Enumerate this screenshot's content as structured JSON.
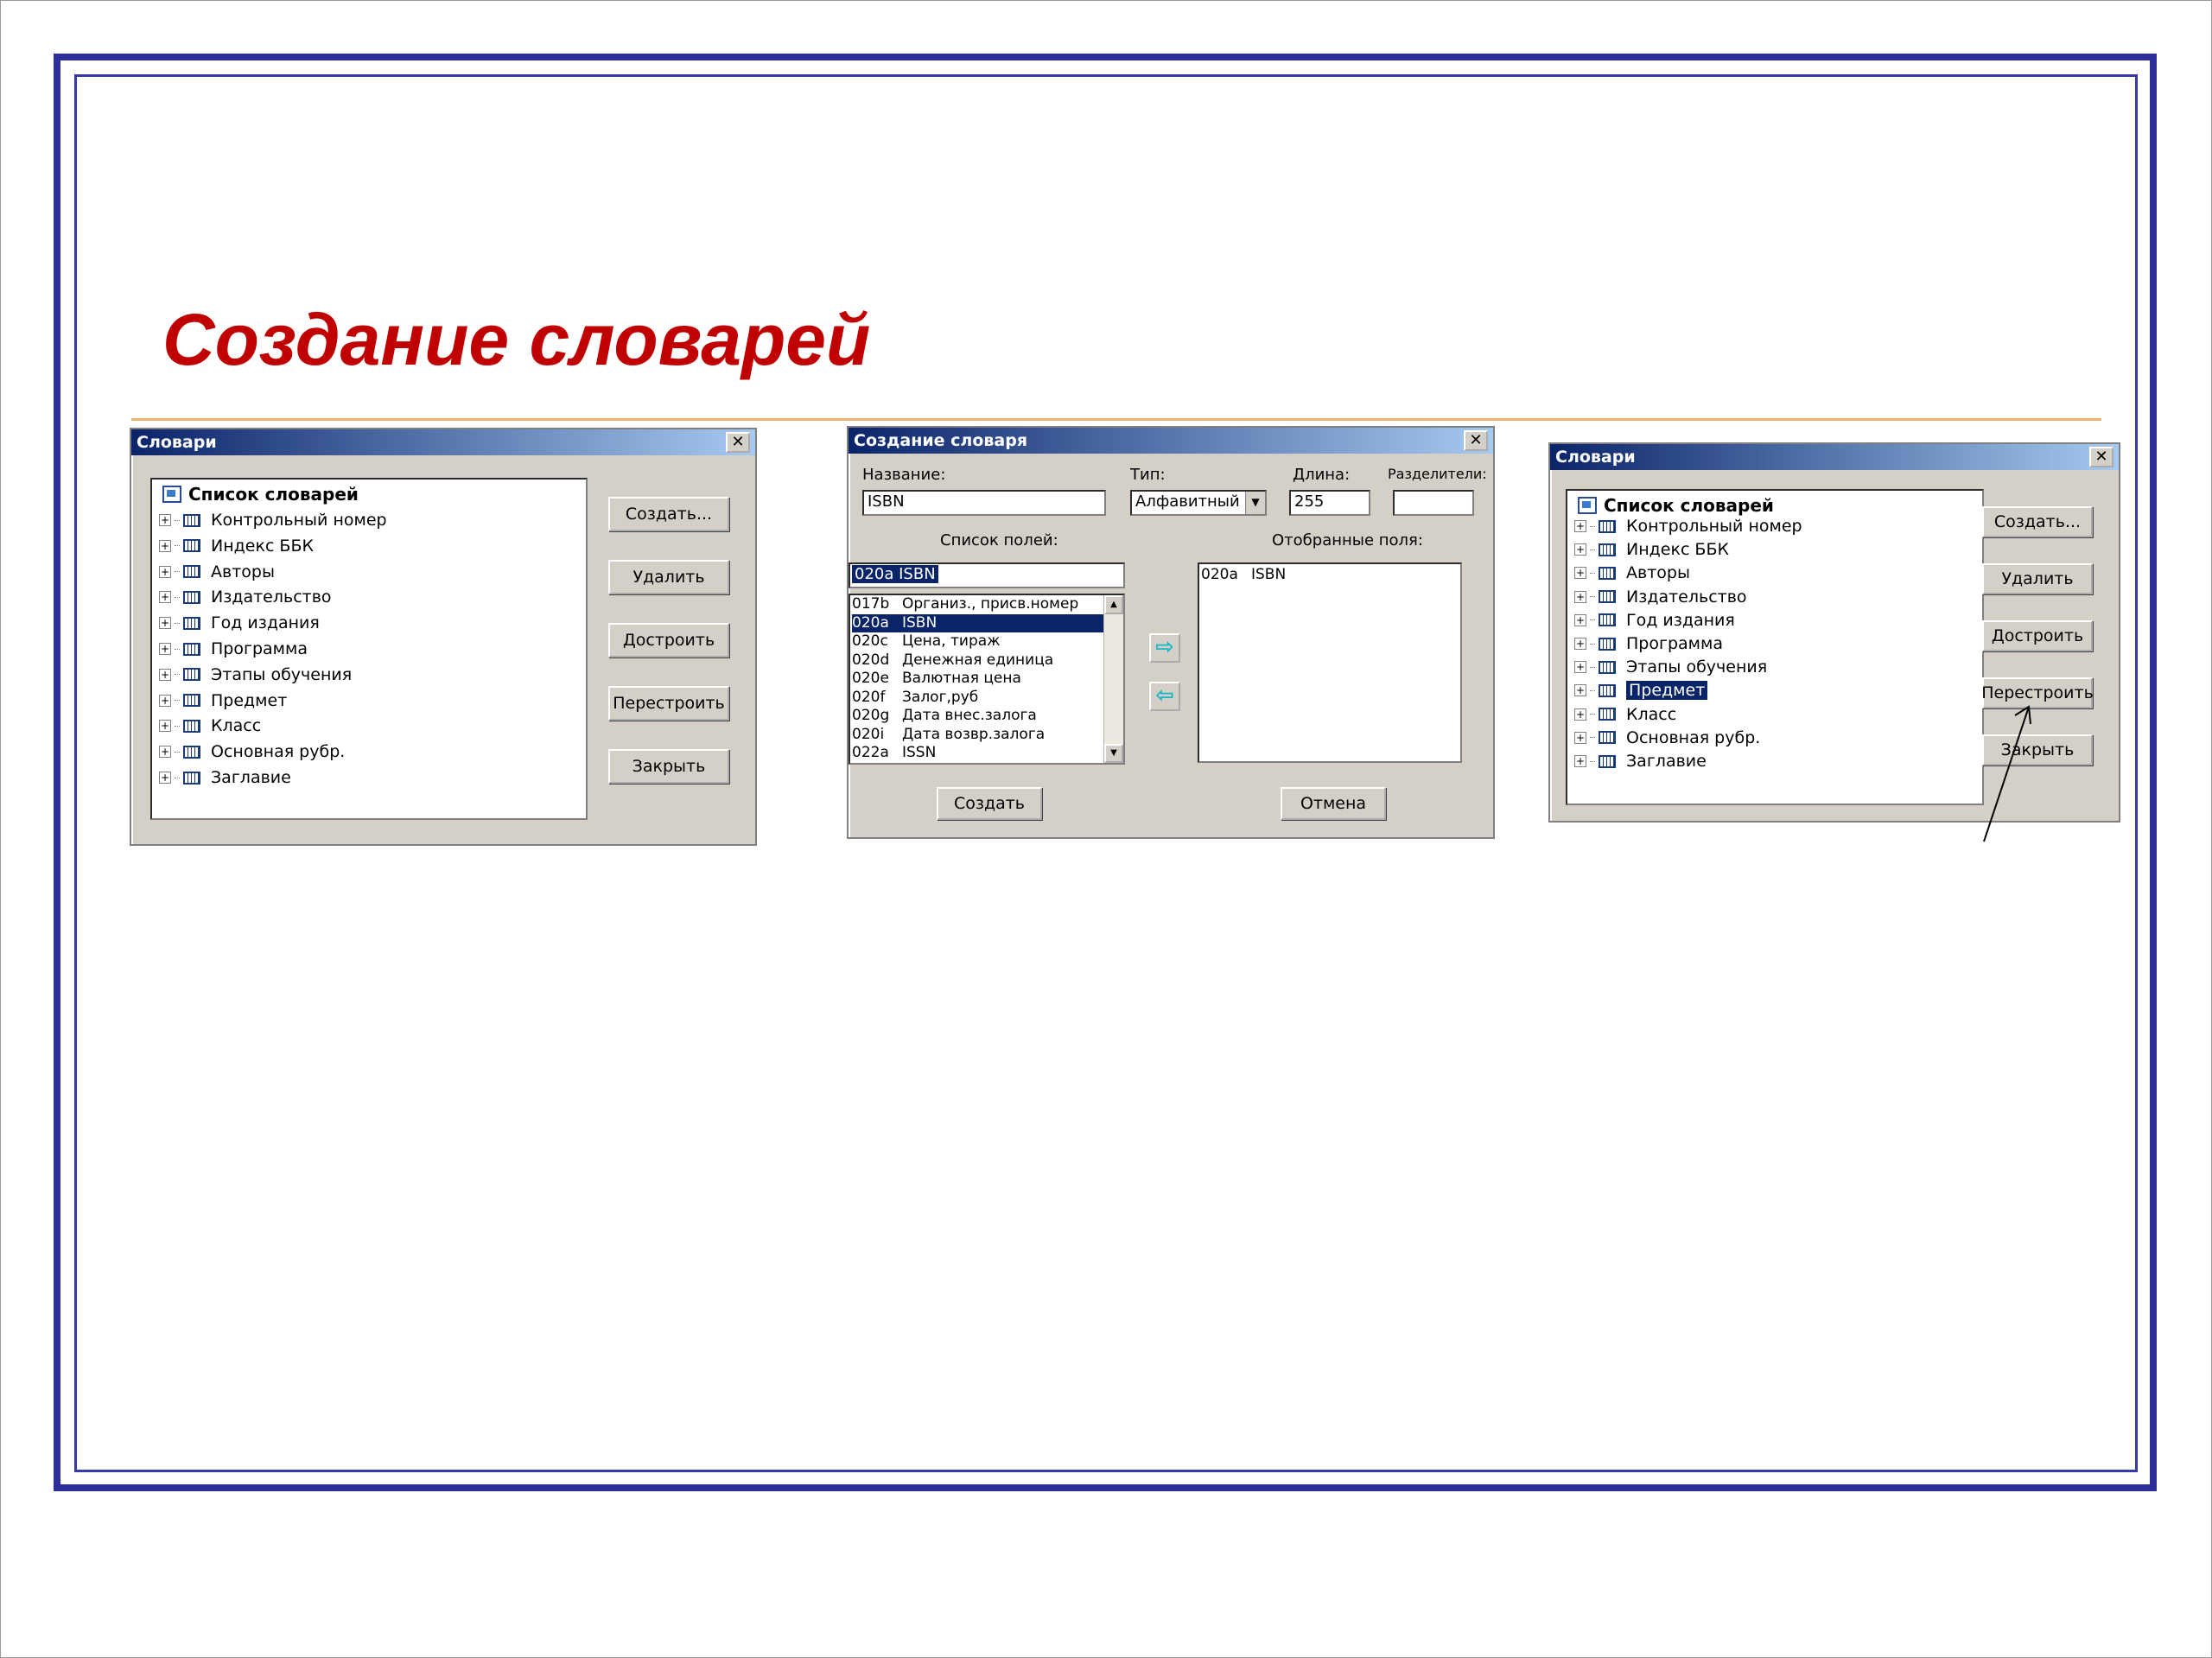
{
  "slide": {
    "title": "Создание словарей"
  },
  "dialog1": {
    "title": "Словари",
    "root": "Список словарей",
    "items": [
      "Контрольный номер",
      "Индекс ББК",
      "Авторы",
      "Издательство",
      "Год издания",
      "Программа",
      "Этапы обучения",
      "Предмет",
      "Класс",
      "Основная рубр.",
      "Заглавие"
    ],
    "buttons": [
      "Создать...",
      "Удалить",
      "Достроить",
      "Перестроить",
      "Закрыть"
    ]
  },
  "dialog2": {
    "title": "Создание словаря",
    "name_label": "Название:",
    "name_value": "ISBN",
    "type_label": "Тип:",
    "type_value": "Алфавитный",
    "length_label": "Длина:",
    "length_value": "255",
    "sep_label": "Разделители:",
    "sep_value": "",
    "fields_label": "Список полей:",
    "selected_label": "Отобранные поля:",
    "field_input": "020a  ISBN",
    "fields": [
      {
        "code": "017b",
        "name": "Организ., присв.номер"
      },
      {
        "code": "020a",
        "name": "ISBN"
      },
      {
        "code": "020c",
        "name": "Цена, тираж"
      },
      {
        "code": "020d",
        "name": "Денежная единица"
      },
      {
        "code": "020e",
        "name": "Валютная цена"
      },
      {
        "code": "020f",
        "name": "Залог,руб"
      },
      {
        "code": "020g",
        "name": "Дата внес.залога"
      },
      {
        "code": "020i",
        "name": "Дата возвр.залога"
      },
      {
        "code": "022a",
        "name": "ISSN"
      }
    ],
    "selected": [
      {
        "code": "020a",
        "name": "ISBN"
      }
    ],
    "create_button": "Создать",
    "cancel_button": "Отмена"
  },
  "dialog3": {
    "title": "Словари",
    "root": "Список словарей",
    "items": [
      "Контрольный номер",
      "Индекс ББК",
      "Авторы",
      "Издательство",
      "Год издания",
      "Программа",
      "Этапы обучения",
      "Предмет",
      "Класс",
      "Основная рубр.",
      "Заглавие"
    ],
    "selected_item": "Предмет",
    "buttons": [
      "Создать...",
      "Удалить",
      "Достроить",
      "Перестроить",
      "Закрыть"
    ]
  }
}
